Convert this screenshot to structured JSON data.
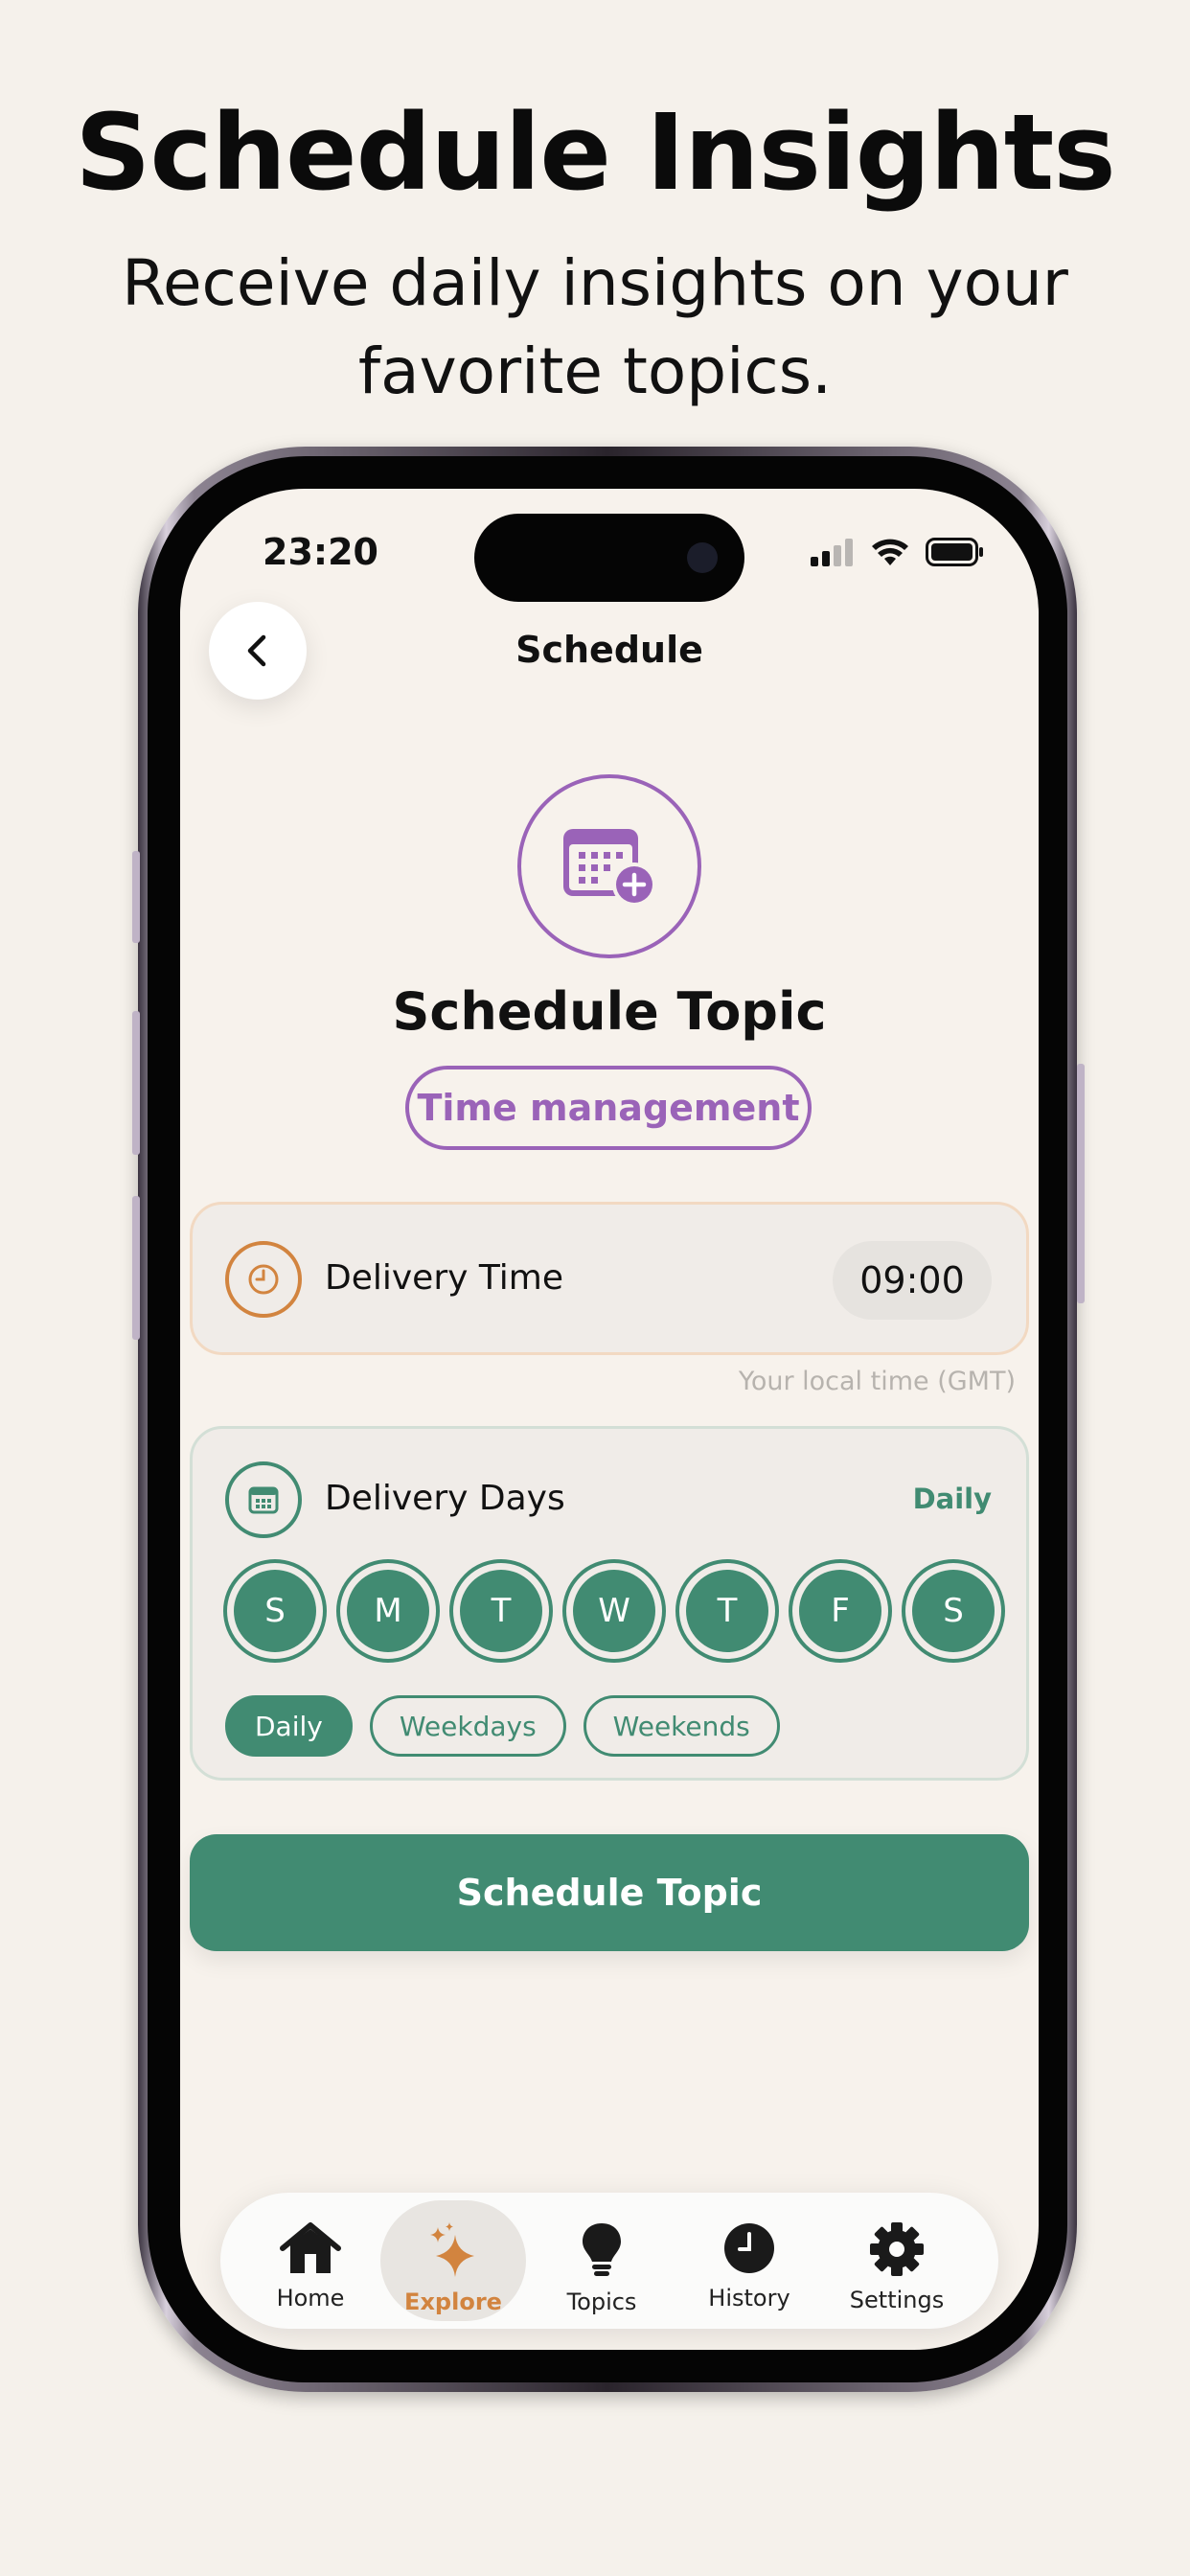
{
  "marketing": {
    "headline": "Schedule Insights",
    "subhead": "Receive daily insights on your favorite topics."
  },
  "status_bar": {
    "time": "23:20",
    "icons": [
      "cellular-signal-icon",
      "wifi-icon",
      "battery-icon"
    ]
  },
  "nav": {
    "back_icon": "chevron-left-icon",
    "title": "Schedule"
  },
  "topic": {
    "icon": "calendar-add-icon",
    "title": "Schedule Topic",
    "name": "Time management"
  },
  "delivery_time": {
    "icon": "clock-icon",
    "label": "Delivery Time",
    "value": "09:00",
    "note": "Your local time (GMT)"
  },
  "delivery_days": {
    "icon": "calendar-icon",
    "label": "Delivery Days",
    "frequency": "Daily",
    "days": [
      {
        "letter": "S",
        "selected": true
      },
      {
        "letter": "M",
        "selected": true
      },
      {
        "letter": "T",
        "selected": true
      },
      {
        "letter": "W",
        "selected": true
      },
      {
        "letter": "T",
        "selected": true
      },
      {
        "letter": "F",
        "selected": true
      },
      {
        "letter": "S",
        "selected": true
      }
    ],
    "presets": [
      {
        "label": "Daily",
        "active": true
      },
      {
        "label": "Weekdays",
        "active": false
      },
      {
        "label": "Weekends",
        "active": false
      }
    ]
  },
  "cta": {
    "label": "Schedule Topic"
  },
  "tabbar": {
    "items": [
      {
        "label": "Home",
        "icon": "home-icon",
        "active": false
      },
      {
        "label": "Explore",
        "icon": "sparkles-icon",
        "active": true
      },
      {
        "label": "Topics",
        "icon": "lightbulb-icon",
        "active": false
      },
      {
        "label": "History",
        "icon": "clock-icon",
        "active": false
      },
      {
        "label": "Settings",
        "icon": "gear-icon",
        "active": false
      }
    ]
  },
  "colors": {
    "background": "#f5f1eb",
    "accent_green": "#418b72",
    "accent_purple": "#9a63b8",
    "accent_orange": "#d2843f"
  }
}
